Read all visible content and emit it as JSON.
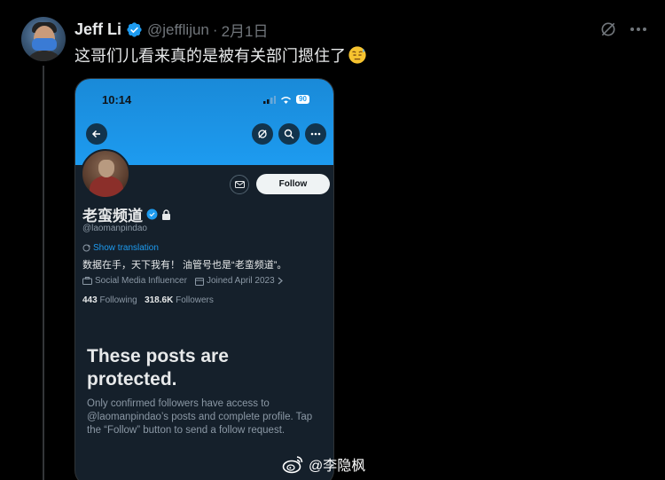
{
  "tweet": {
    "author_name": "Jeff Li",
    "handle": "@jefflijun",
    "separator": "·",
    "date": "2月1日",
    "text": "这哥们儿看来真的是被有关部门摁住了"
  },
  "profile_screenshot": {
    "status_time": "10:14",
    "battery": "90",
    "follow_label": "Follow",
    "display_name": "老蛮频道",
    "handle": "@laomanpindao",
    "show_translation": "Show translation",
    "bio": "数据在手，天下我有！ 油管号也是“老蛮频道”。",
    "category": "Social Media Influencer",
    "joined": "Joined April 2023",
    "following_count": "443",
    "following_label": "Following",
    "followers_count": "318.6K",
    "followers_label": "Followers",
    "protected_title": "These posts are protected.",
    "protected_body": "Only confirmed followers have access to @laomanpindao’s posts and complete profile. Tap the “Follow” button to send a follow request."
  },
  "watermark": {
    "text": "@李隐枫"
  },
  "colors": {
    "background": "#000000",
    "accent": "#1d9bf0",
    "muted": "#71767b"
  },
  "icons": [
    "verified-badge-icon",
    "grok-icon",
    "more-icon",
    "back-arrow-icon",
    "search-icon",
    "mail-icon",
    "lock-icon",
    "translate-icon",
    "briefcase-icon",
    "calendar-icon",
    "weibo-icon",
    "downcast-face-emoji"
  ]
}
